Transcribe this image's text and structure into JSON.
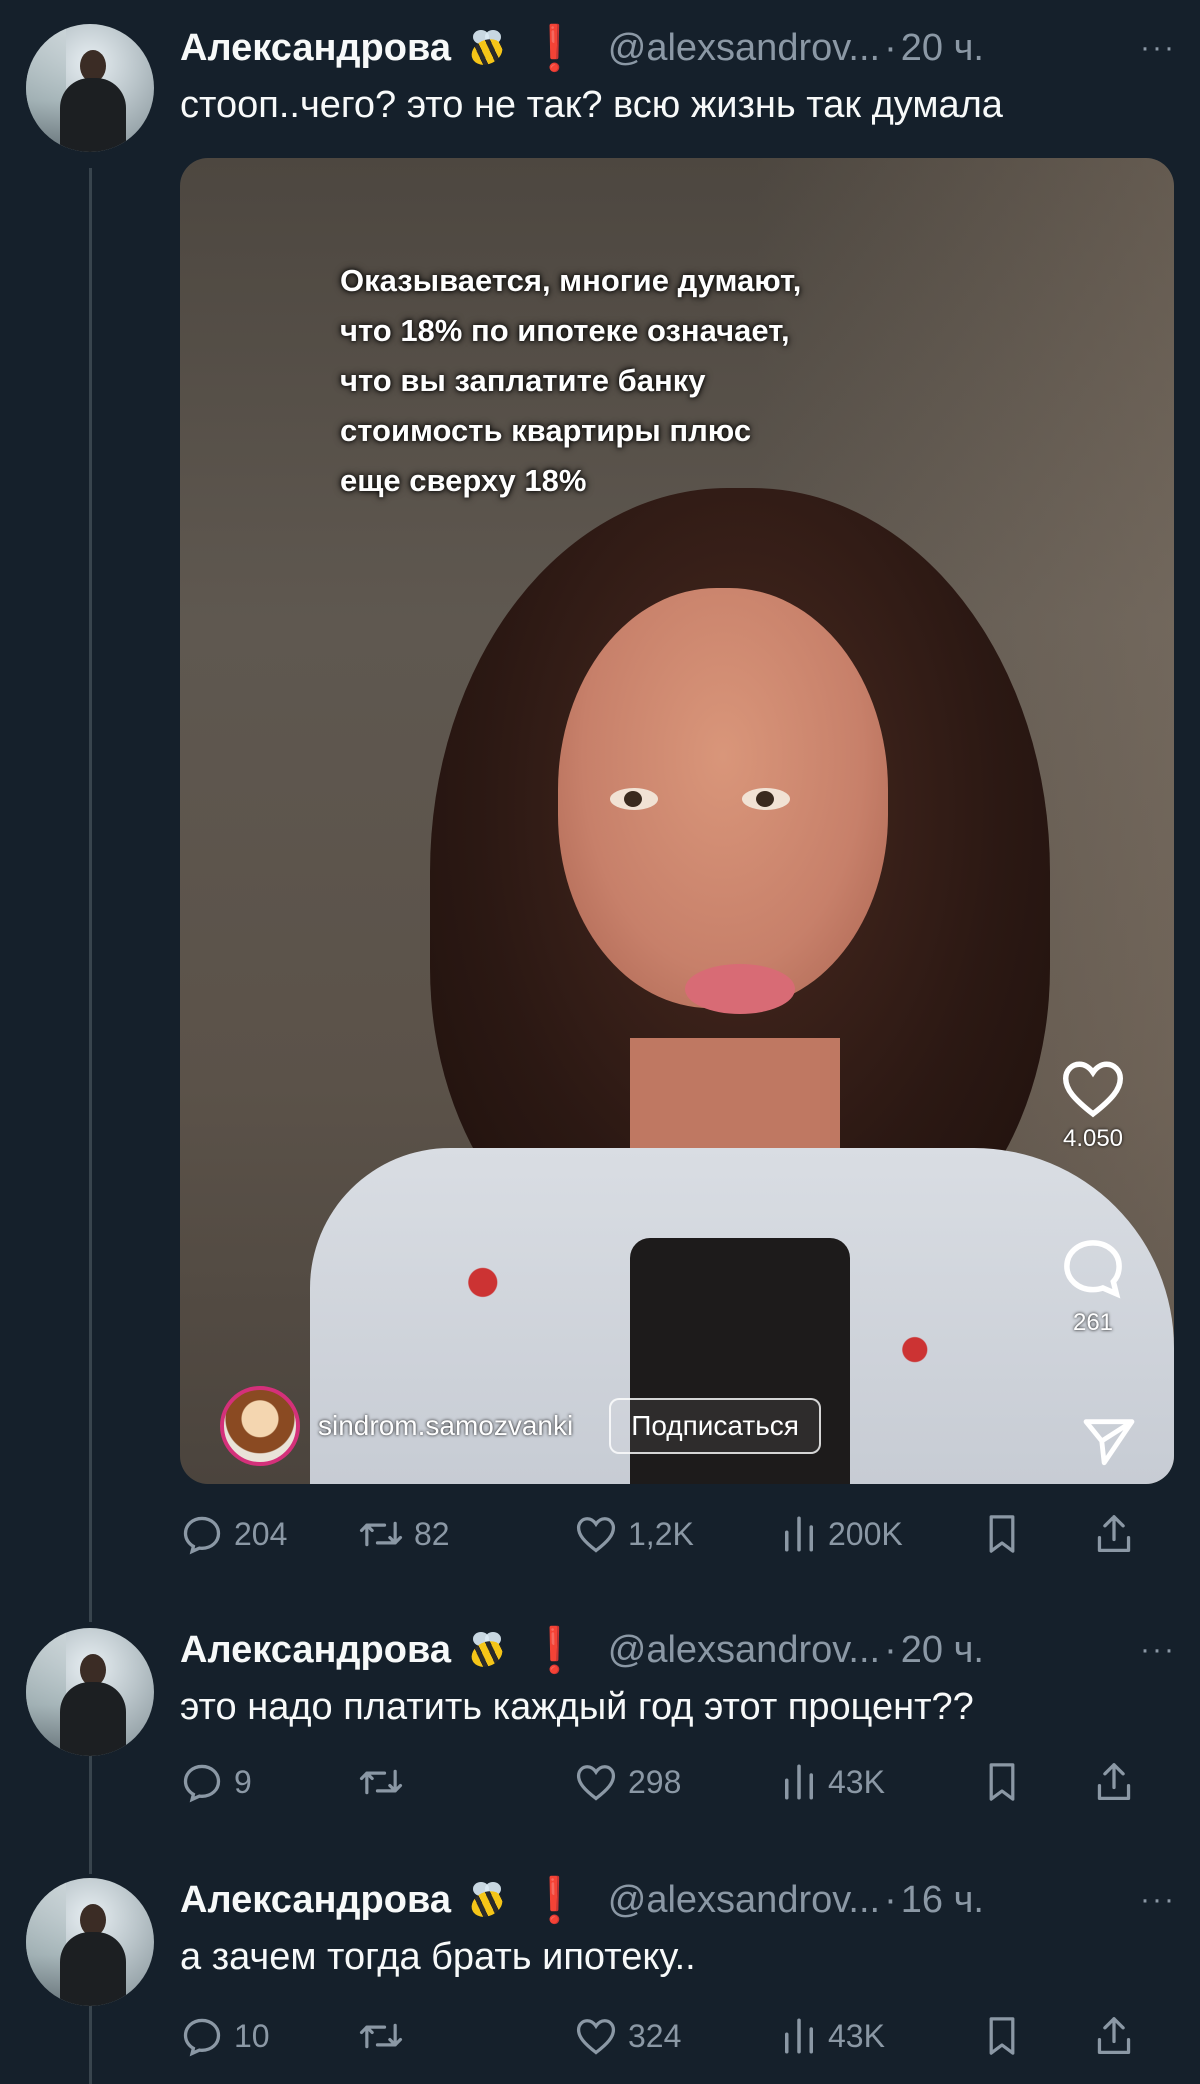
{
  "colors": {
    "background": "#15202b",
    "text": "#f7f9f9",
    "muted": "#8b98a5",
    "alert": "#e0245e"
  },
  "tweets": [
    {
      "name": "Александрова",
      "badge_emoji": "bee",
      "badge_exclaim": "❗",
      "handle": "@alexsandrov...",
      "dot": "·",
      "time": "20 ч.",
      "more": "···",
      "text": "стооп..чего? это не так? всю жизнь так думала",
      "media": {
        "overlay_lines": [
          "Оказывается, многие думают,",
          "что 18% по ипотеке означает,",
          "что вы заплатите банку",
          "стоимость квартиры плюс",
          "еще сверху 18%"
        ],
        "likes": "4.050",
        "comments": "261",
        "account": "sindrom.samozvanki",
        "follow_label": "Подписаться"
      },
      "stats": {
        "replies": "204",
        "retweets": "82",
        "likes": "1,2K",
        "views": "200K"
      }
    },
    {
      "name": "Александрова",
      "badge_emoji": "bee",
      "badge_exclaim": "❗",
      "handle": "@alexsandrov...",
      "dot": "·",
      "time": "20 ч.",
      "more": "···",
      "text": "это надо платить каждый год этот процент??",
      "stats": {
        "replies": "9",
        "retweets": "",
        "likes": "298",
        "views": "43K"
      }
    },
    {
      "name": "Александрова",
      "badge_emoji": "bee",
      "badge_exclaim": "❗",
      "handle": "@alexsandrov...",
      "dot": "·",
      "time": "16 ч.",
      "more": "···",
      "text": "а зачем тогда брать ипотеку..",
      "stats": {
        "replies": "10",
        "retweets": "",
        "likes": "324",
        "views": "43K"
      }
    }
  ]
}
